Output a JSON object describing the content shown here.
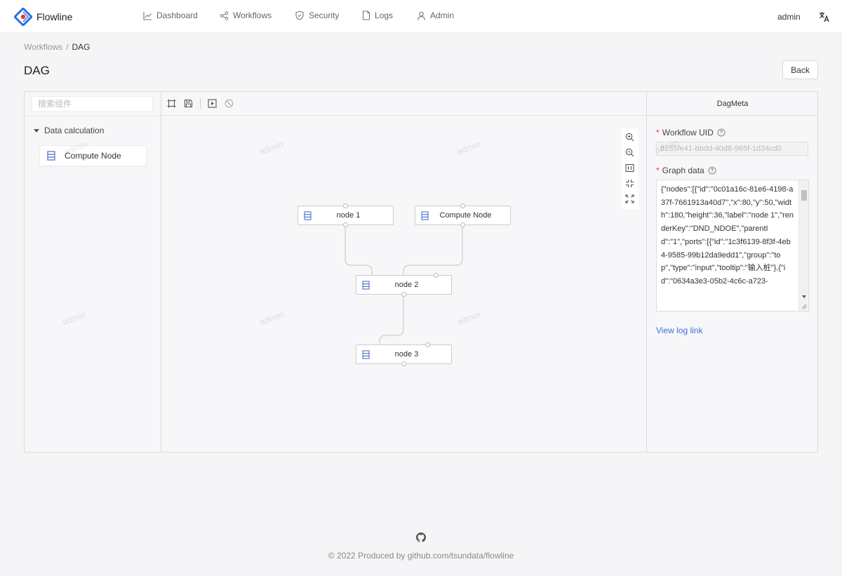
{
  "app": {
    "name": "Flowline",
    "accent": "#2f6fe0",
    "logo_red": "#e4393c"
  },
  "nav": [
    {
      "label": "Dashboard",
      "icon": "line-chart-icon"
    },
    {
      "label": "Workflows",
      "icon": "share-nodes-icon"
    },
    {
      "label": "Security",
      "icon": "shield-icon"
    },
    {
      "label": "Logs",
      "icon": "file-icon"
    },
    {
      "label": "Admin",
      "icon": "user-icon"
    }
  ],
  "header": {
    "user": "admin",
    "lang_icon": "translate-icon"
  },
  "breadcrumb": {
    "parent": "Workflows",
    "separator": "/",
    "current": "DAG"
  },
  "page": {
    "title": "DAG",
    "back_label": "Back"
  },
  "left_panel": {
    "search_placeholder": "搜索组件",
    "group": "Data calculation",
    "component": "Compute Node"
  },
  "watermark": "admin",
  "graph": {
    "nodes": [
      {
        "label": "node 1"
      },
      {
        "label": "Compute Node"
      },
      {
        "label": "node 2"
      },
      {
        "label": "node 3"
      }
    ]
  },
  "right_panel": {
    "title": "DagMeta",
    "uid_label": "Workflow UID",
    "uid_value": "8155fe41-bbdd-40d8-965f-1d34cd0",
    "graph_label": "Graph data",
    "graph_text": "{\"nodes\":[{\"id\":\"0c01a16c-81e6-4198-a37f-7661913a40d7\",\"x\":80,\"y\":50,\"width\":180,\"height\":36,\"label\":\"node 1\",\"renderKey\":\"DND_NDOE\",\"parentId\":\"1\",\"ports\":[{\"id\":\"1c3f6139-8f3f-4eb4-9585-99b12da9edd1\",\"group\":\"top\",\"type\":\"input\",\"tooltip\":\"输入桩\"},{\"id\":\"0634a3e3-05b2-4c6c-a723-",
    "log_link": "View log link"
  },
  "footer": {
    "text": "© 2022 Produced by github.com/tsundata/flowline"
  }
}
